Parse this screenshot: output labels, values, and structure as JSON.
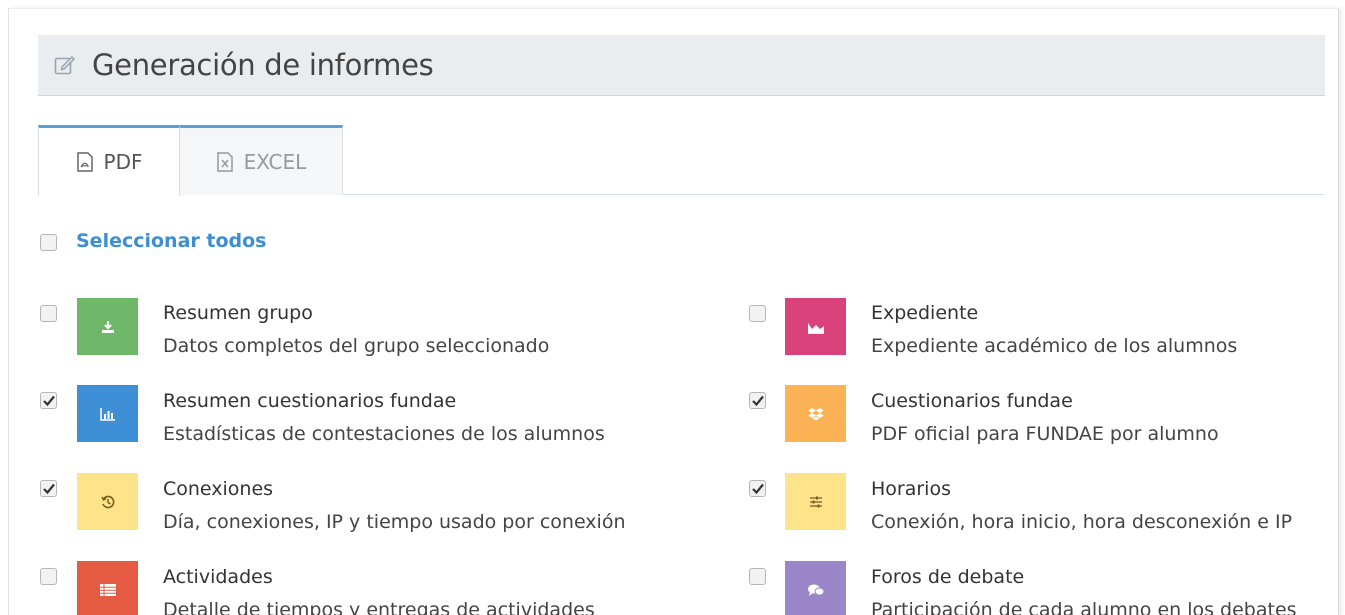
{
  "header": {
    "title": "Generación de informes",
    "icon": "edit-icon"
  },
  "tabs": [
    {
      "label": "PDF",
      "icon": "pdf-file-icon",
      "active": true
    },
    {
      "label": "EXCEL",
      "icon": "excel-file-icon",
      "active": false
    }
  ],
  "select_all": {
    "label": "Seleccionar todos",
    "checked": false
  },
  "reports": [
    {
      "name": "Resumen grupo",
      "desc": "Datos completos del grupo seleccionado",
      "checked": false,
      "icon": "download-icon",
      "color": "#6fb869"
    },
    {
      "name": "Expediente",
      "desc": "Expediente académico de los alumnos",
      "checked": false,
      "icon": "area-chart-icon",
      "color": "#d9417a"
    },
    {
      "name": "Resumen cuestionarios fundae",
      "desc": "Estadísticas de contestaciones de los alumnos",
      "checked": true,
      "icon": "bar-chart-icon",
      "color": "#3f8fd6"
    },
    {
      "name": "Cuestionarios fundae",
      "desc": "PDF oficial para FUNDAE por alumno",
      "checked": true,
      "icon": "dropbox-icon",
      "color": "#fcb355"
    },
    {
      "name": "Conexiones",
      "desc": "Día, conexiones, IP y tiempo usado por conexión",
      "checked": true,
      "icon": "history-icon",
      "color": "#fde38a"
    },
    {
      "name": "Horarios",
      "desc": "Conexión, hora inicio, hora desconexión e IP",
      "checked": true,
      "icon": "sliders-icon",
      "color": "#fde38a"
    },
    {
      "name": "Actividades",
      "desc": "Detalle de tiempos y entregas de actividades",
      "checked": false,
      "icon": "list-icon",
      "color": "#e45a43"
    },
    {
      "name": "Foros de debate",
      "desc": "Participación de cada alumno en los debates",
      "checked": false,
      "icon": "comments-icon",
      "color": "#9a86c8"
    }
  ]
}
